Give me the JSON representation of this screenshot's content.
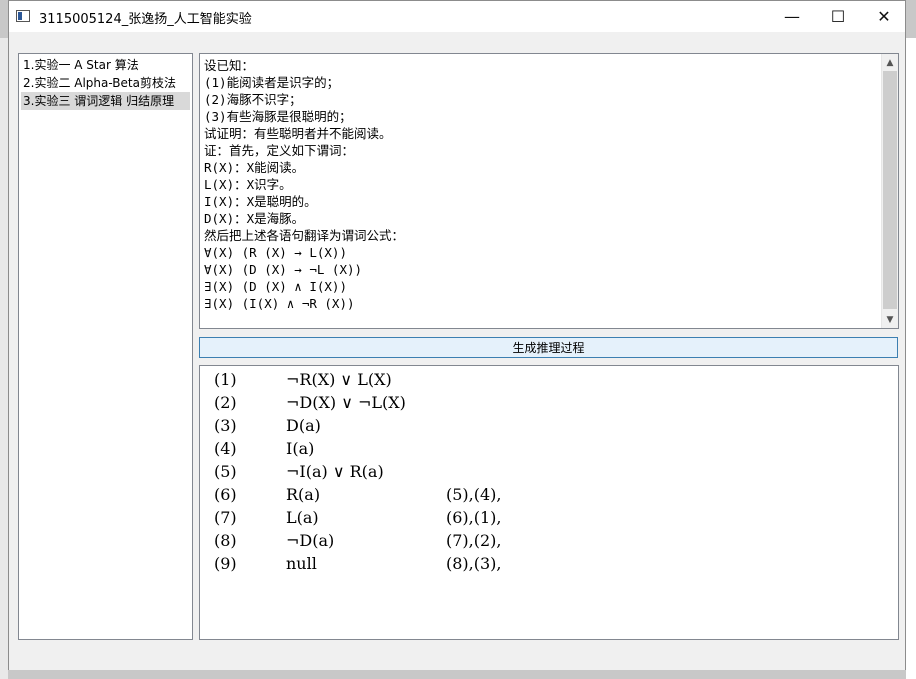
{
  "window": {
    "title": "3115005124_张逸扬_人工智能实验",
    "controls": {
      "minimize": "—",
      "maximize": "☐",
      "close": "✕"
    }
  },
  "sidebar": {
    "items": [
      {
        "label": "1.实验一  A Star 算法",
        "selected": false
      },
      {
        "label": "2.实验二  Alpha-Beta剪枝法",
        "selected": false
      },
      {
        "label": "3.实验三  谓词逻辑 归结原理",
        "selected": true
      }
    ]
  },
  "input_text": {
    "lines": [
      "设已知：",
      "(1)能阅读者是识字的；",
      "(2)海豚不识字；",
      "(3)有些海豚是很聪明的；",
      "试证明：有些聪明者并不能阅读。",
      "证：首先，定义如下谓词：",
      "R(X)：X能阅读。",
      "L(X)：X识字。",
      "I(X)：X是聪明的。",
      "D(X)：X是海豚。",
      "然后把上述各语句翻译为谓词公式：",
      "∀(X) (R (X) → L(X))",
      "∀(X) (D (X) → ¬L (X))",
      "∃(X) (D (X) ∧ I(X))",
      "∃(X) (I(X) ∧ ¬R (X))"
    ],
    "scroll_up": "▲",
    "scroll_down": "▼"
  },
  "generate_button": {
    "label": "生成推理过程"
  },
  "proof": {
    "steps": [
      {
        "no": "(1)",
        "expr": "¬R(X) ∨ L(X)",
        "ref": ""
      },
      {
        "no": "(2)",
        "expr": "¬D(X) ∨ ¬L(X)",
        "ref": ""
      },
      {
        "no": "(3)",
        "expr": "D(a)",
        "ref": ""
      },
      {
        "no": "(4)",
        "expr": "I(a)",
        "ref": ""
      },
      {
        "no": "(5)",
        "expr": "¬I(a) ∨ R(a)",
        "ref": ""
      },
      {
        "no": "(6)",
        "expr": "R(a)",
        "ref": "(5),(4),"
      },
      {
        "no": "(7)",
        "expr": "L(a)",
        "ref": "(6),(1),"
      },
      {
        "no": "(8)",
        "expr": "¬D(a)",
        "ref": "(7),(2),"
      },
      {
        "no": "(9)",
        "expr": "null",
        "ref": "(8),(3),"
      }
    ]
  }
}
